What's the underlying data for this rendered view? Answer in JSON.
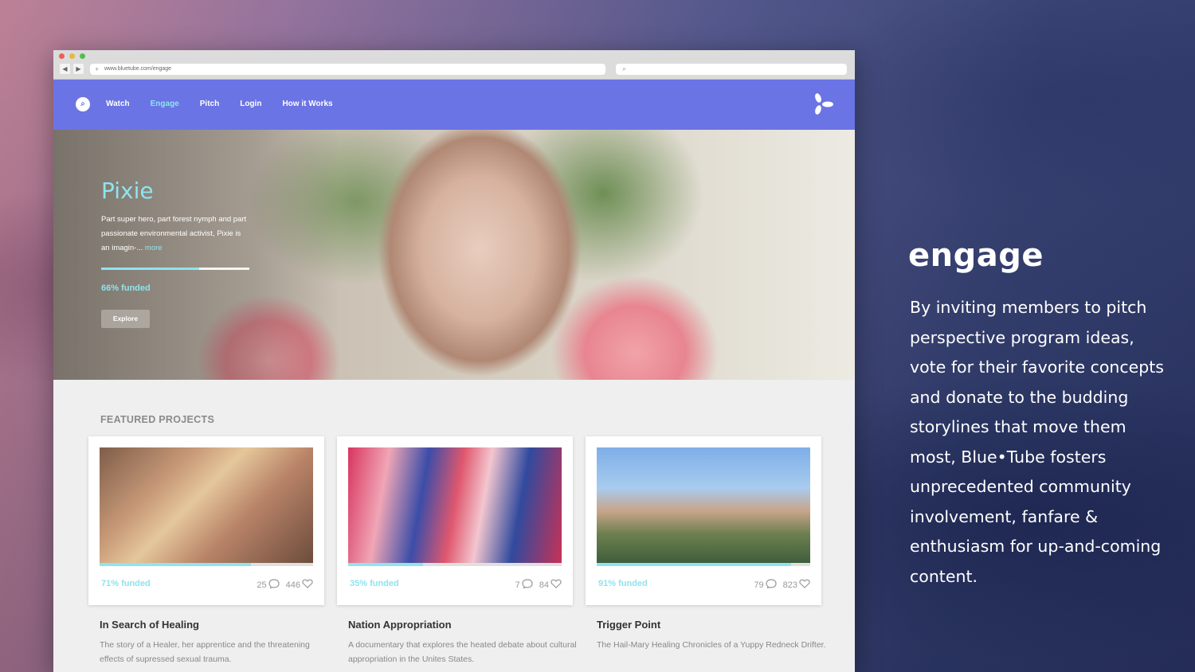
{
  "browser": {
    "url": "www.bluetube.com/engage",
    "back_icon": "◀",
    "forward_icon": "▶"
  },
  "nav": {
    "links": [
      "Watch",
      "Engage",
      "Pitch",
      "Login",
      "How it Works"
    ],
    "active": "Engage"
  },
  "hero": {
    "title": "Pixie",
    "description": "Part super hero, part forest nymph and part passionate environmental activist, Pixie is an imagin-...",
    "more_link": "more",
    "funded_percent": 66,
    "funded_label": "66% funded",
    "explore_label": "Explore"
  },
  "featured": {
    "heading": "FEATURED PROJECTS",
    "projects": [
      {
        "funded_percent": 71,
        "funded_label": "71% funded",
        "comments": "25",
        "likes": "446",
        "title": "In Search of Healing",
        "description": "The story of a Healer, her apprentice and the threatening effects of supressed sexual trauma."
      },
      {
        "funded_percent": 35,
        "funded_label": "35% funded",
        "comments": "7",
        "likes": "84",
        "title": "Nation Appropriation",
        "description": "A documentary that explores the heated debate about cultural appropriation in the Unites States."
      },
      {
        "funded_percent": 91,
        "funded_label": "91% funded",
        "comments": "79",
        "likes": "823",
        "title": "Trigger Point",
        "description": "The Hail-Mary Healing Chronicles of a Yuppy Redneck Drifter."
      }
    ]
  },
  "side": {
    "title": "engage",
    "body": "By inviting members to pitch perspective program ideas, vote for their favorite concepts and donate to the budding storylines that move them most, Blue•Tube fosters unprecedented community involvement, fanfare & enthusiasm for up-and-coming content."
  },
  "colors": {
    "accent": "#8ee4ef",
    "nav_bg": "#6b74e4"
  }
}
